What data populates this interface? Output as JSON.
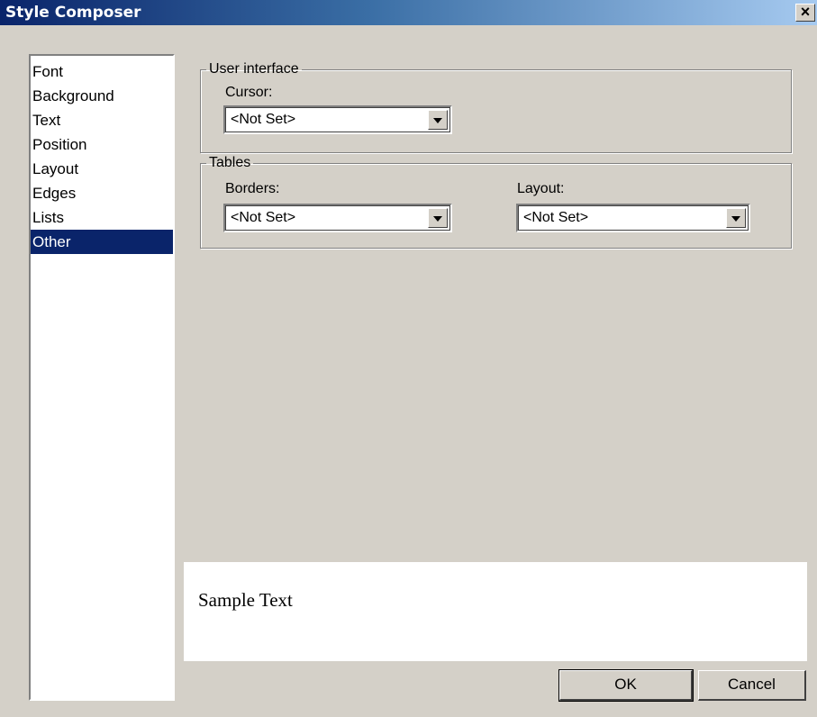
{
  "window": {
    "title": "Style Composer",
    "close_label": "✕"
  },
  "categories": [
    "Font",
    "Background",
    "Text",
    "Position",
    "Layout",
    "Edges",
    "Lists",
    "Other"
  ],
  "selected_category": "Other",
  "user_interface": {
    "legend": "User interface",
    "cursor_label": "Cursor:",
    "cursor_value": "<Not Set>"
  },
  "tables": {
    "legend": "Tables",
    "borders_label": "Borders:",
    "borders_value": "<Not Set>",
    "layout_label": "Layout:",
    "layout_value": "<Not Set>"
  },
  "preview": {
    "text": "Sample Text"
  },
  "buttons": {
    "ok": "OK",
    "cancel": "Cancel"
  },
  "colors": {
    "selection": "#0a246a",
    "dialog_bg": "#d4d0c8"
  }
}
